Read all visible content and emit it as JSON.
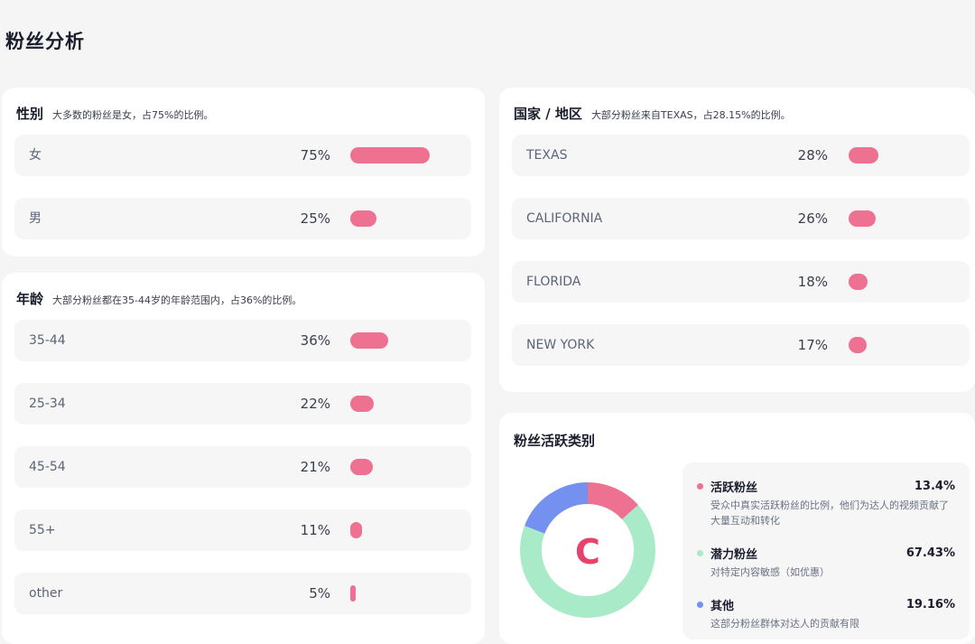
{
  "page": {
    "title": "粉丝分析"
  },
  "gender": {
    "title": "性别",
    "desc": "大多数的粉丝是女，占75%的比例。",
    "rows": [
      {
        "label": "女",
        "pct_text": "75%",
        "value": 75
      },
      {
        "label": "男",
        "pct_text": "25%",
        "value": 25
      }
    ]
  },
  "age": {
    "title": "年龄",
    "desc": "大部分粉丝都在35-44岁的年龄范围内，占36%的比例。",
    "rows": [
      {
        "label": "35-44",
        "pct_text": "36%",
        "value": 36
      },
      {
        "label": "25-34",
        "pct_text": "22%",
        "value": 22
      },
      {
        "label": "45-54",
        "pct_text": "21%",
        "value": 21
      },
      {
        "label": "55+",
        "pct_text": "11%",
        "value": 11
      },
      {
        "label": "other",
        "pct_text": "5%",
        "value": 5
      }
    ]
  },
  "region": {
    "title": "国家 / 地区",
    "desc": "大部分粉丝来自TEXAS，占28.15%的比例。",
    "rows": [
      {
        "label": "TEXAS",
        "pct_text": "28%",
        "value": 28
      },
      {
        "label": "CALIFORNIA",
        "pct_text": "26%",
        "value": 26
      },
      {
        "label": "FLORIDA",
        "pct_text": "18%",
        "value": 18
      },
      {
        "label": "NEW YORK",
        "pct_text": "17%",
        "value": 17
      }
    ]
  },
  "activity": {
    "title": "粉丝活跃类别",
    "grade": "C",
    "grade_color": "#e8416b",
    "items": [
      {
        "name": "活跃粉丝",
        "value_text": "13.4%",
        "value": 13.4,
        "color": "#ee7192",
        "desc": "受众中真实活跃粉丝的比例，他们为达人的视频贡献了大量互动和转化"
      },
      {
        "name": "潜力粉丝",
        "value_text": "67.43%",
        "value": 67.43,
        "color": "#a9ebc8",
        "desc": "对特定内容敏感（如优惠）"
      },
      {
        "name": "其他",
        "value_text": "19.16%",
        "value": 19.16,
        "color": "#7491f0",
        "desc": "这部分粉丝群体对达人的贡献有限"
      }
    ]
  },
  "colors": {
    "bar": "#ee7192",
    "row_bg": "#f6f6f7",
    "page_bg": "#f5f5f6"
  }
}
